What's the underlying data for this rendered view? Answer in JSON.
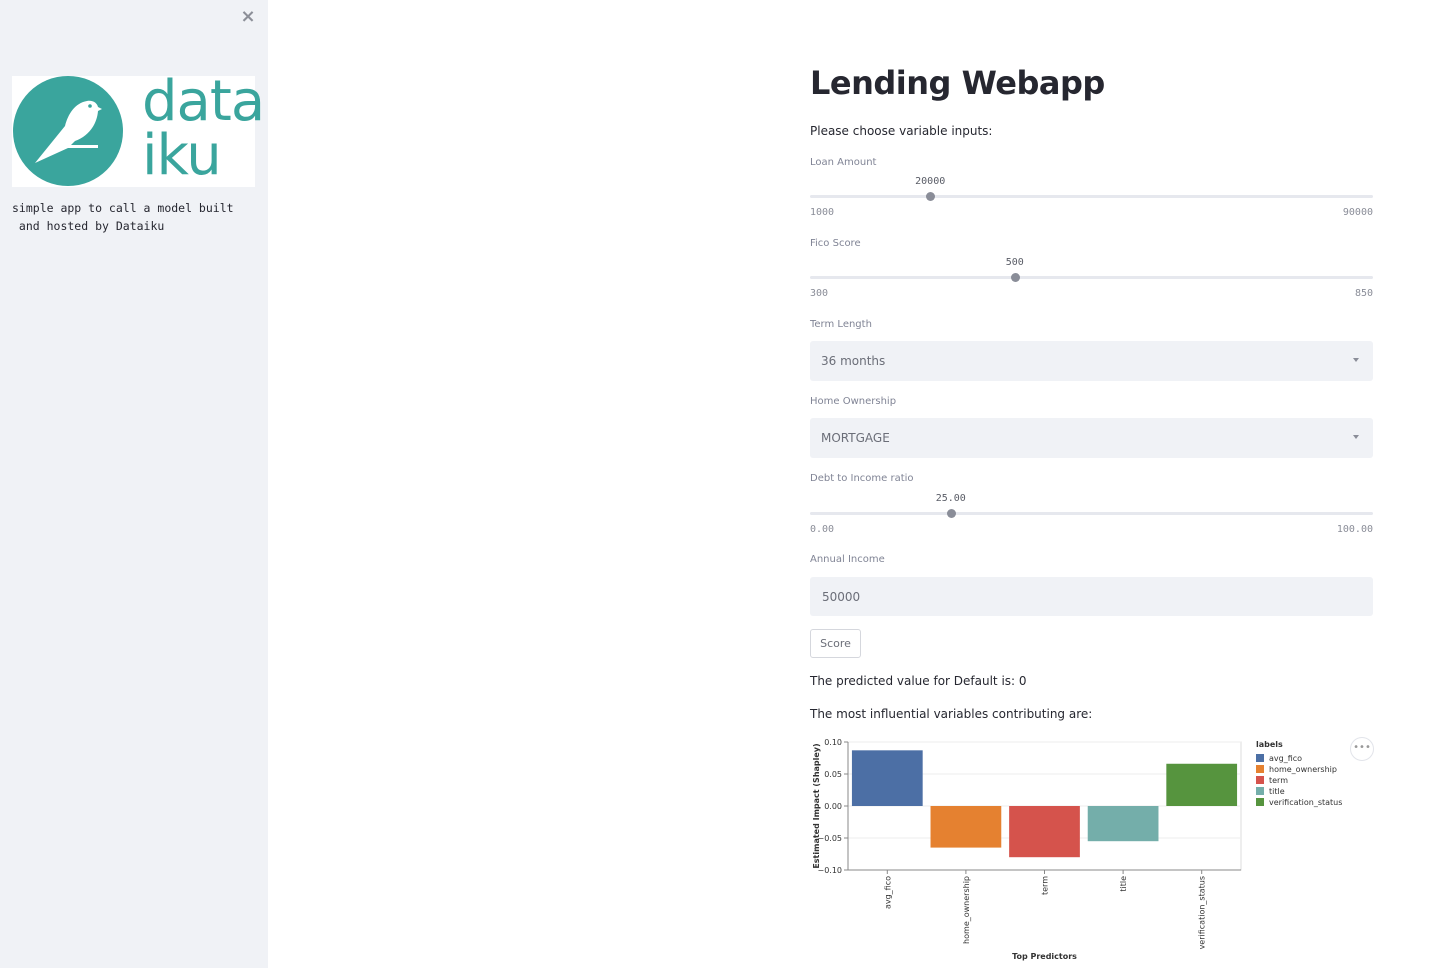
{
  "sidebar": {
    "close_label": "×",
    "logo_line1": "data",
    "logo_line2": "iku",
    "description": "simple app to call a model built\n and hosted by Dataiku"
  },
  "main": {
    "title": "Lending Webapp",
    "prompt": "Please choose variable inputs:",
    "loan_amount": {
      "label": "Loan Amount",
      "value": "20000",
      "min": "1000",
      "max": "90000",
      "numeric": 20000,
      "lo": 1000,
      "hi": 90000
    },
    "fico_score": {
      "label": "Fico Score",
      "value": "500",
      "min": "300",
      "max": "850",
      "numeric": 500,
      "lo": 300,
      "hi": 850
    },
    "term_length": {
      "label": "Term Length",
      "selected": "36 months"
    },
    "home_ownership": {
      "label": "Home Ownership",
      "selected": "MORTGAGE"
    },
    "dti": {
      "label": "Debt to Income ratio",
      "value": "25.00",
      "min": "0.00",
      "max": "100.00",
      "numeric": 25,
      "lo": 0,
      "hi": 100
    },
    "annual_income": {
      "label": "Annual Income",
      "value": "50000"
    },
    "score_button": "Score",
    "prediction_text": "The predicted value for Default is: 0",
    "influential_text": "The most influential variables contributing are:",
    "chart_menu": "•••"
  },
  "chart_data": {
    "type": "bar",
    "categories": [
      "avg_fico",
      "home_ownership",
      "term",
      "title",
      "verification_status"
    ],
    "values": [
      0.087,
      -0.065,
      -0.08,
      -0.055,
      0.066
    ],
    "colors": [
      "#4c6fa5",
      "#e58130",
      "#d5534c",
      "#74aeaa",
      "#56943e"
    ],
    "xlabel": "Top Predictors",
    "ylabel": "Estimated Impact (Shapley)",
    "ylim": [
      -0.1,
      0.1
    ],
    "yticks": [
      "0.10",
      "0.05",
      "0.00",
      "−0.05",
      "−0.10"
    ],
    "ytick_values": [
      0.1,
      0.05,
      0,
      -0.05,
      -0.1
    ],
    "legend_title": "labels",
    "legend_position": "right"
  }
}
